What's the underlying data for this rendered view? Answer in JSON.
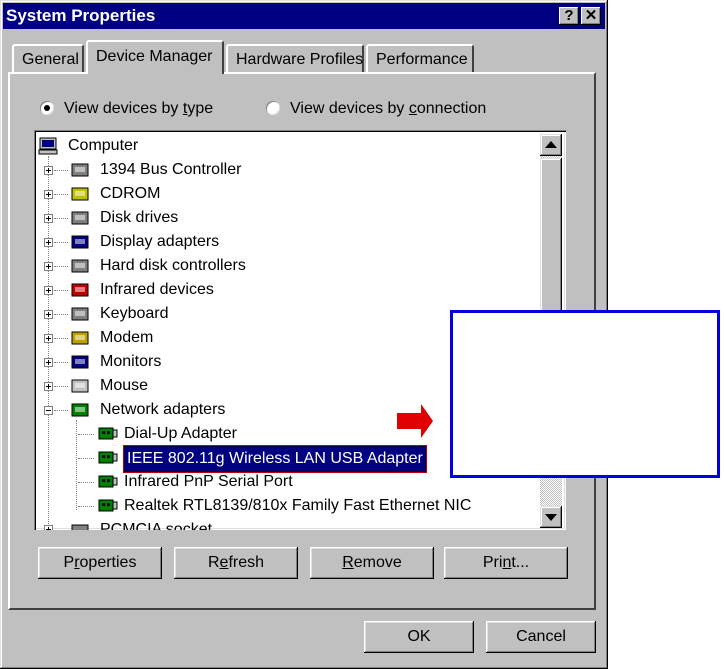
{
  "window": {
    "title": "System Properties",
    "help_label": "?",
    "close_label": "✕"
  },
  "tabs": [
    {
      "label": "General"
    },
    {
      "label": "Device Manager",
      "active": true
    },
    {
      "label": "Hardware Profiles"
    },
    {
      "label": "Performance"
    }
  ],
  "view_options": {
    "by_type": {
      "pre": "View devices by ",
      "key": "t",
      "post": "ype",
      "selected": true
    },
    "by_connection": {
      "pre": "View devices by ",
      "key": "c",
      "post": "onnection",
      "selected": false
    }
  },
  "tree": {
    "root": "Computer",
    "items": [
      {
        "label": "1394 Bus Controller",
        "icon": "bus-controller-icon"
      },
      {
        "label": "CDROM",
        "icon": "cdrom-icon"
      },
      {
        "label": "Disk drives",
        "icon": "disk-drive-icon"
      },
      {
        "label": "Display adapters",
        "icon": "display-adapter-icon"
      },
      {
        "label": "Hard disk controllers",
        "icon": "hard-disk-controller-icon"
      },
      {
        "label": "Infrared devices",
        "icon": "infrared-icon"
      },
      {
        "label": "Keyboard",
        "icon": "keyboard-icon"
      },
      {
        "label": "Modem",
        "icon": "modem-icon"
      },
      {
        "label": "Monitors",
        "icon": "monitor-icon"
      },
      {
        "label": "Mouse",
        "icon": "mouse-icon"
      },
      {
        "label": "Network adapters",
        "icon": "network-adapter-icon",
        "expanded": true
      }
    ],
    "network_children": [
      {
        "label": "Dial-Up Adapter"
      },
      {
        "label": "IEEE 802.11g Wireless LAN USB Adapter",
        "selected": true
      },
      {
        "label": "Infrared PnP Serial Port"
      },
      {
        "label": "Realtek RTL8139/810x Family Fast Ethernet NIC"
      }
    ],
    "partial_item": "PCMCIA socket"
  },
  "buttons": {
    "properties": {
      "pre": "P",
      "key": "r",
      "post": "operties"
    },
    "refresh": {
      "pre": "R",
      "key": "e",
      "post": "fresh"
    },
    "remove": {
      "pre": "",
      "key": "R",
      "post": "emove"
    },
    "print": {
      "pre": "Pri",
      "key": "n",
      "post": "t..."
    },
    "ok": "OK",
    "cancel": "Cancel"
  },
  "colors": {
    "titlebar": "#000080",
    "selection": "#000080",
    "arrow": "#e00000",
    "callout_border": "#0000e0"
  }
}
